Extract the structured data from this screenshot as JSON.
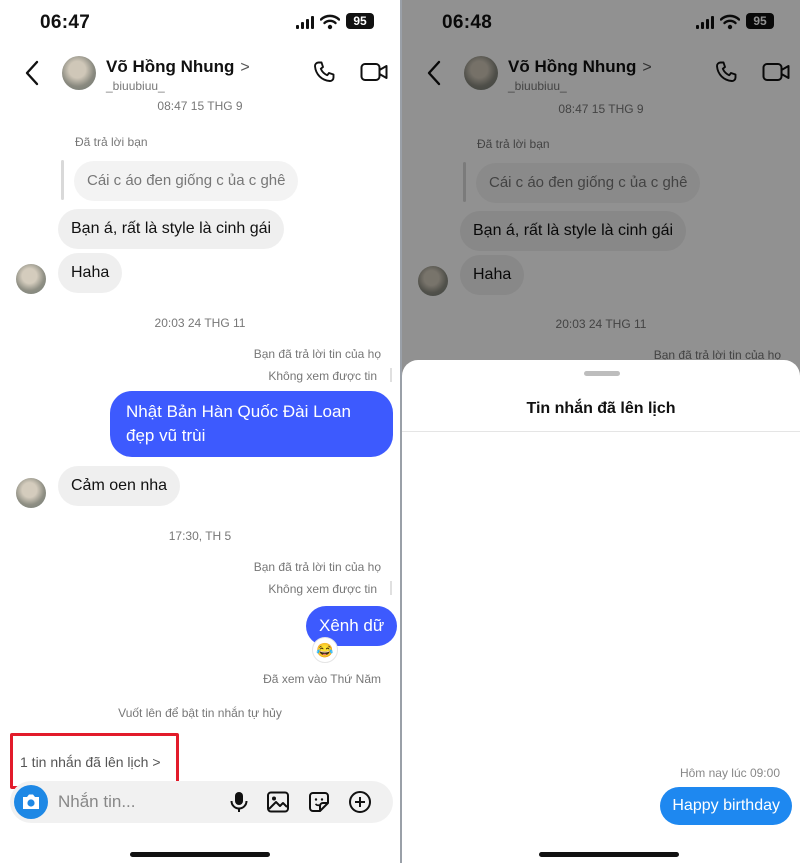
{
  "left": {
    "status": {
      "time": "06:47",
      "battery": "95"
    },
    "header": {
      "name": "Võ Hồng Nhung",
      "chevron": ">",
      "handle": "_biuubiuu_"
    },
    "messages": {
      "ts1": "08:47 15 THG 9",
      "replied_you": "Đã trả lời bạn",
      "quoted": "Cái c áo đen giống c ủa c ghê",
      "in1": "Bạn á, rất là style là cinh gái",
      "in2": "Haha",
      "ts2": "20:03 24 THG 11",
      "you_replied": "Bạn đã trả lời tin của họ",
      "unavailable": "Không xem được tin",
      "out1": "Nhật Bản Hàn Quốc Đài Loan đẹp vũ trùi",
      "in3": "Cảm oen nha",
      "ts3": "17:30, TH 5",
      "you_replied2": "Bạn đã trả lời tin của họ",
      "unavailable2": "Không xem được tin",
      "out2": "Xênh dữ",
      "reaction": "😂",
      "seen": "Đã xem vào Thứ Năm",
      "vanish_hint": "Vuốt lên để bật tin nhắn tự hủy"
    },
    "scheduled_link": "1 tin nhắn đã lên lịch",
    "scheduled_chevron": ">",
    "composer": {
      "placeholder": "Nhắn tin..."
    }
  },
  "right": {
    "status": {
      "time": "06:48",
      "battery": "95"
    },
    "header": {
      "name": "Võ Hồng Nhung",
      "chevron": ">",
      "handle": "_biuubiuu_"
    },
    "messages": {
      "ts1": "08:47 15 THG 9",
      "replied_you": "Đã trả lời bạn",
      "quoted": "Cái c áo đen giống c ủa c ghê",
      "in1": "Bạn á, rất là style là cinh gái",
      "in2": "Haha",
      "ts2": "20:03 24 THG 11",
      "you_replied": "Bạn đã trả lời tin của họ"
    },
    "sheet": {
      "title": "Tin nhắn đã lên lịch",
      "scheduled_time": "Hôm nay lúc 09:00",
      "scheduled_message": "Happy birthday"
    }
  },
  "colors": {
    "outgoing_bubble": "#3d5afe",
    "scheduled_bubble": "#1e88f0",
    "highlight_border": "#e21b2a",
    "incoming_bubble": "#efefef"
  }
}
